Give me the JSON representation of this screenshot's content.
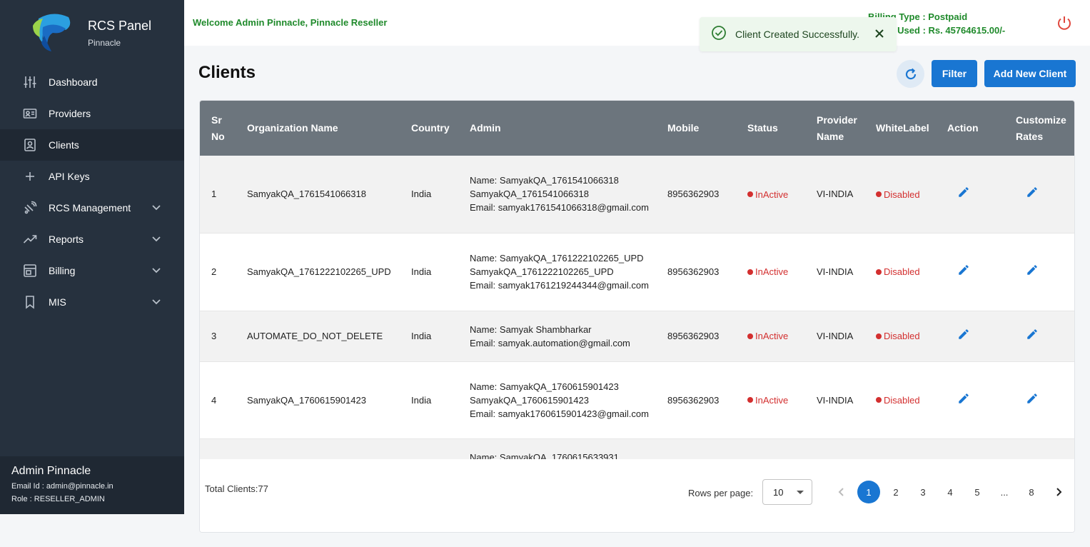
{
  "brand": {
    "title": "RCS Panel",
    "subtitle": "Pinnacle"
  },
  "nav": [
    {
      "label": "Dashboard",
      "icon": "sliders-icon",
      "active": false,
      "expandable": false
    },
    {
      "label": "Providers",
      "icon": "id-card-icon",
      "active": false,
      "expandable": false
    },
    {
      "label": "Clients",
      "icon": "contact-card-icon",
      "active": true,
      "expandable": false
    },
    {
      "label": "API Keys",
      "icon": "plus-icon",
      "active": false,
      "expandable": false
    },
    {
      "label": "RCS Management",
      "icon": "satellite-icon",
      "active": false,
      "expandable": true
    },
    {
      "label": "Reports",
      "icon": "trending-up-icon",
      "active": false,
      "expandable": true
    },
    {
      "label": "Billing",
      "icon": "billing-icon",
      "active": false,
      "expandable": true
    },
    {
      "label": "MIS",
      "icon": "bookmark-icon",
      "active": false,
      "expandable": true
    }
  ],
  "user": {
    "name": "Admin Pinnacle",
    "email": "Email Id : admin@pinnacle.in",
    "role": "Role : RESELLER_ADMIN"
  },
  "topbar": {
    "welcome": "Welcome Admin Pinnacle, Pinnacle Reseller",
    "billing_type": "Billing Type : Postpaid",
    "credit_used": "Credit Used : Rs. 45764615.00/-"
  },
  "toast": {
    "message": "Client Created Successfully."
  },
  "page": {
    "title": "Clients",
    "filter_label": "Filter",
    "add_label": "Add New Client"
  },
  "table": {
    "headers": {
      "sr": "Sr No",
      "org": "Organization Name",
      "country": "Country",
      "admin": "Admin",
      "mobile": "Mobile",
      "status": "Status",
      "provider": "Provider Name",
      "whitelabel": "WhiteLabel",
      "action": "Action",
      "rates": "Customize Rates"
    },
    "rows": [
      {
        "sr": "1",
        "org": "SamyakQA_1761541066318",
        "country": "India",
        "admin_name": "Name: SamyakQA_1761541066318 SamyakQA_1761541066318",
        "admin_email": "Email: samyak1761541066318@gmail.com",
        "mobile": "8956362903",
        "status": "InActive",
        "provider": "VI-INDIA",
        "whitelabel": "Disabled"
      },
      {
        "sr": "2",
        "org": "SamyakQA_1761222102265_UPD",
        "country": "India",
        "admin_name": "Name: SamyakQA_1761222102265_UPD SamyakQA_1761222102265_UPD",
        "admin_email": "Email: samyak1761219244344@gmail.com",
        "mobile": "8956362903",
        "status": "InActive",
        "provider": "VI-INDIA",
        "whitelabel": "Disabled"
      },
      {
        "sr": "3",
        "org": "AUTOMATE_DO_NOT_DELETE",
        "country": "India",
        "admin_name": "Name: Samyak Shambharkar",
        "admin_email": "Email: samyak.automation@gmail.com",
        "mobile": "8956362903",
        "status": "InActive",
        "provider": "VI-INDIA",
        "whitelabel": "Disabled"
      },
      {
        "sr": "4",
        "org": "SamyakQA_1760615901423",
        "country": "India",
        "admin_name": "Name: SamyakQA_1760615901423 SamyakQA_1760615901423",
        "admin_email": "Email: samyak1760615901423@gmail.com",
        "mobile": "8956362903",
        "status": "InActive",
        "provider": "VI-INDIA",
        "whitelabel": "Disabled"
      },
      {
        "sr": "",
        "org": "",
        "country": "",
        "admin_name": "Name: SamyakQA_1760615633931",
        "admin_email": "",
        "mobile": "",
        "status": "",
        "provider": "",
        "whitelabel": ""
      }
    ]
  },
  "footer": {
    "total": "Total Clients:77",
    "rows_per_page_label": "Rows per page:",
    "rows_per_page_value": "10",
    "pages": [
      "1",
      "2",
      "3",
      "4",
      "5",
      "...",
      "8"
    ],
    "current_page": "1"
  },
  "colors": {
    "sidebar": "#26313e",
    "accent": "#1976d2",
    "header": "#6c757d",
    "success": "#1f8a2b",
    "danger": "#d32f2f"
  }
}
